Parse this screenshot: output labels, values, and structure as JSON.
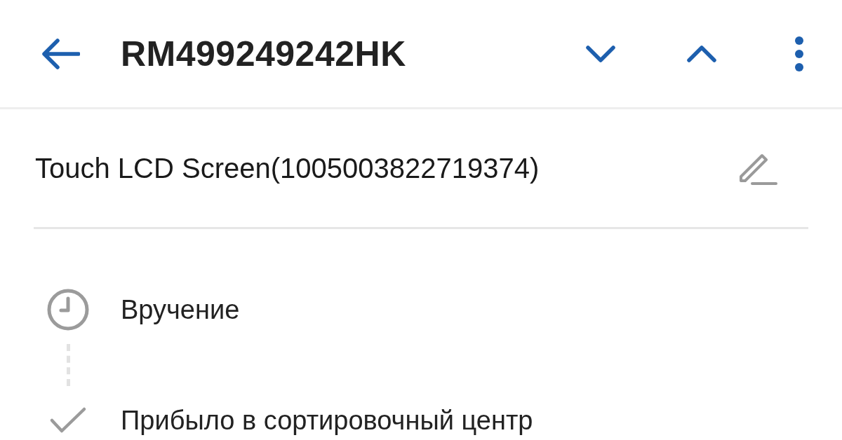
{
  "header": {
    "title": "RM499249242HK"
  },
  "item": {
    "title": "Touch LCD Screen(1005003822719374)"
  },
  "events": [
    {
      "kind": "pending",
      "text": "Вручение"
    },
    {
      "kind": "done",
      "text": "Прибыло в сортировочный центр"
    }
  ]
}
